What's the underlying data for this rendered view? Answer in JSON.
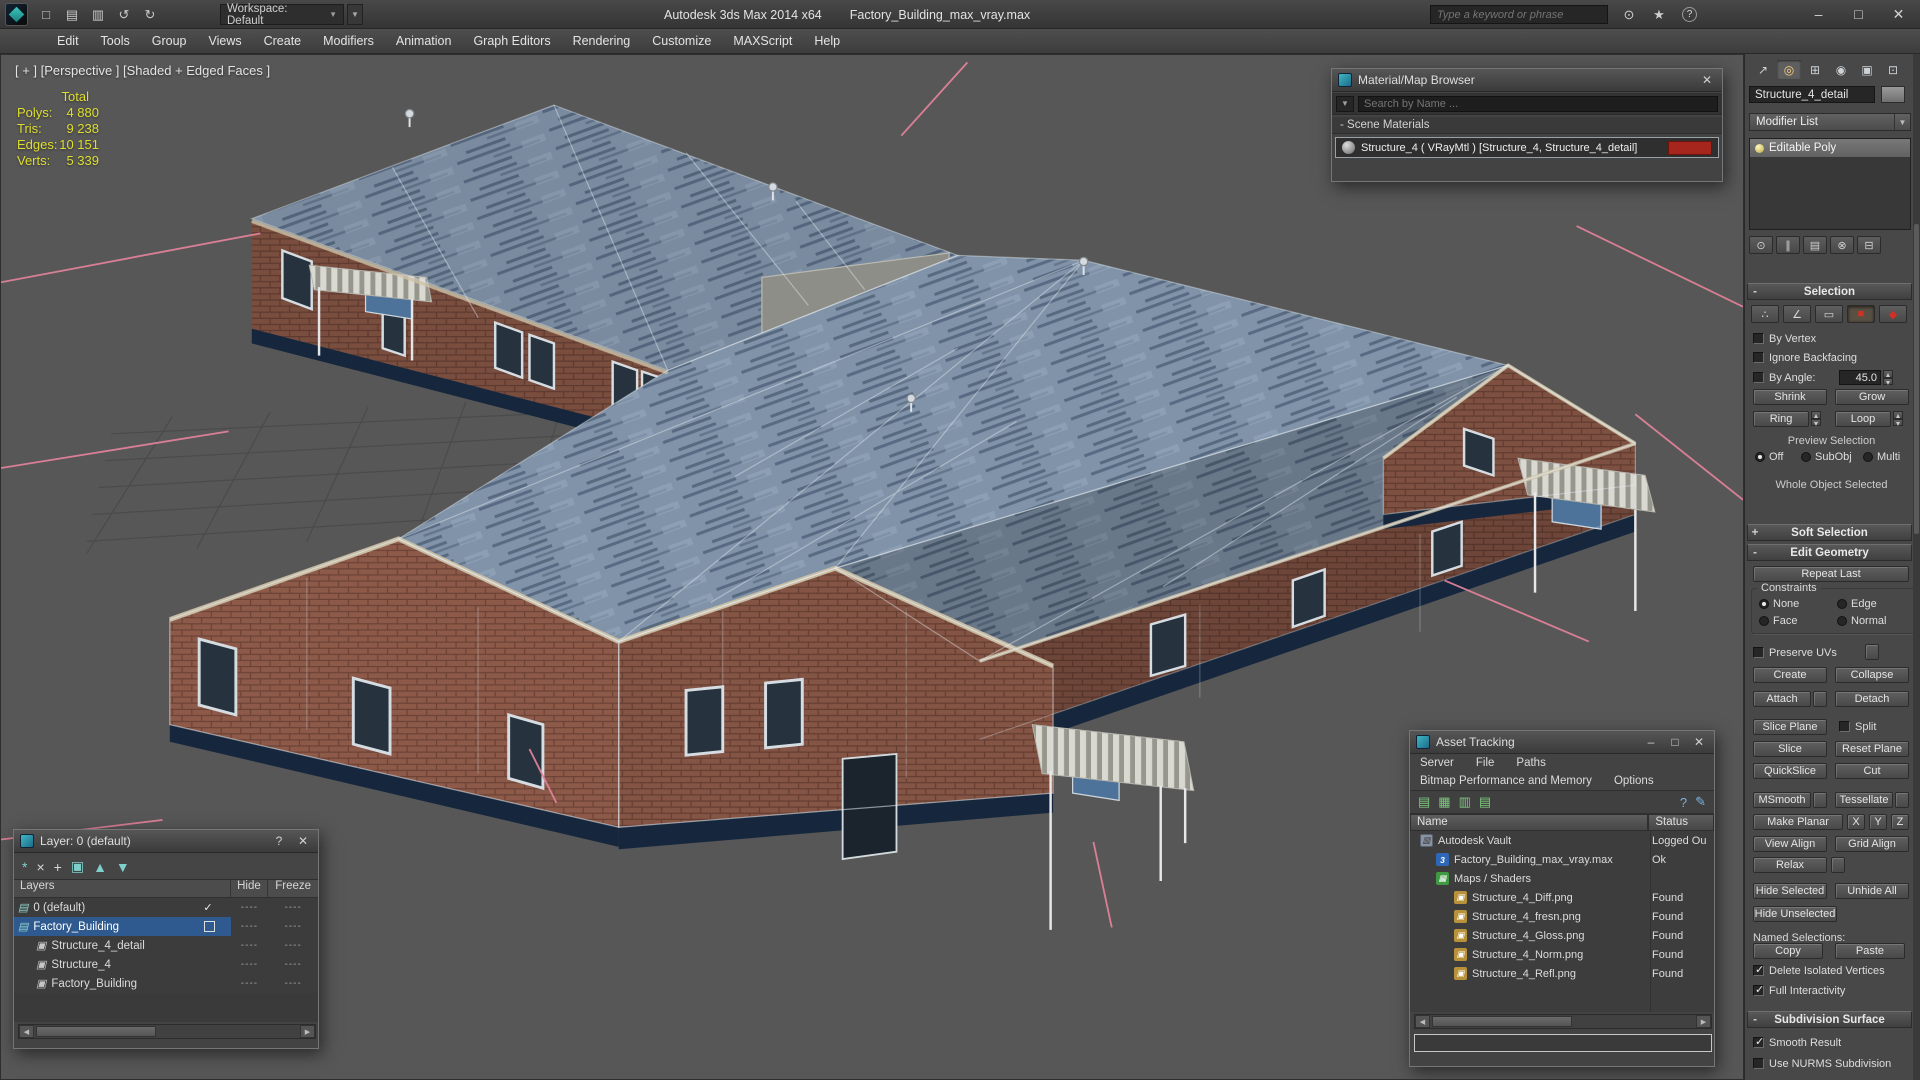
{
  "titlebar": {
    "app_title": "Autodesk 3ds Max 2014 x64",
    "file_name": "Factory_Building_max_vray.max",
    "workspace": "Workspace: Default",
    "search_placeholder": "Type a keyword or phrase"
  },
  "menus": [
    "Edit",
    "Tools",
    "Group",
    "Views",
    "Create",
    "Modifiers",
    "Animation",
    "Graph Editors",
    "Rendering",
    "Customize",
    "MAXScript",
    "Help"
  ],
  "viewport": {
    "label": "[ + ] [Perspective ] [Shaded + Edged Faces ]",
    "stats": {
      "total": "Total",
      "rows": [
        {
          "label": "Polys:",
          "value": "4 880"
        },
        {
          "label": "Tris:",
          "value": "9 238"
        },
        {
          "label": "Edges:",
          "value": "10 151"
        },
        {
          "label": "Verts:",
          "value": "5 339"
        }
      ]
    }
  },
  "material_browser": {
    "title": "Material/Map Browser",
    "search_placeholder": "Search by Name ...",
    "section": "- Scene Materials",
    "material_name": "Structure_4 ( VRayMtl ) [Structure_4, Structure_4_detail]"
  },
  "layer_panel": {
    "title": "Layer: 0 (default)",
    "columns": [
      "Layers",
      "Hide",
      "Freeze"
    ],
    "dash": "----",
    "rows": [
      {
        "name": "0 (default)"
      },
      {
        "name": "Factory_Building"
      },
      {
        "name": "Structure_4_detail"
      },
      {
        "name": "Structure_4"
      },
      {
        "name": "Factory_Building"
      }
    ]
  },
  "asset_tracking": {
    "title": "Asset Tracking",
    "menu": [
      "Server",
      "File",
      "Paths"
    ],
    "menu2": [
      "Bitmap Performance and Memory",
      "Options"
    ],
    "columns": [
      "Name",
      "Status"
    ],
    "rows": [
      {
        "name": "Autodesk Vault",
        "status": "Logged Out"
      },
      {
        "name": "Factory_Building_max_vray.max",
        "status": "Ok"
      },
      {
        "name": "Maps / Shaders",
        "status": ""
      },
      {
        "name": "Structure_4_Diff.png",
        "status": "Found"
      },
      {
        "name": "Structure_4_fresn.png",
        "status": "Found"
      },
      {
        "name": "Structure_4_Gloss.png",
        "status": "Found"
      },
      {
        "name": "Structure_4_Norm.png",
        "status": "Found"
      },
      {
        "name": "Structure_4_Refl.png",
        "status": "Found"
      }
    ]
  },
  "command_panel": {
    "object_name": "Structure_4_detail",
    "modifier_list": "Modifier List",
    "stack": [
      "Editable Poly"
    ],
    "selection": {
      "title": "Selection",
      "by_vertex": "By Vertex",
      "ignore_backfacing": "Ignore Backfacing",
      "by_angle": "By Angle:",
      "angle": "45.0",
      "shrink": "Shrink",
      "grow": "Grow",
      "ring": "Ring",
      "loop": "Loop",
      "preview": "Preview Selection",
      "off": "Off",
      "subobj": "SubObj",
      "multi": "Multi",
      "whole_object": "Whole Object Selected"
    },
    "soft_selection": {
      "title": "Soft Selection"
    },
    "edit_geometry": {
      "title": "Edit Geometry",
      "repeat_last": "Repeat Last",
      "constraints": "Constraints",
      "none": "None",
      "edge": "Edge",
      "face": "Face",
      "normal": "Normal",
      "preserve_uvs": "Preserve UVs",
      "create": "Create",
      "collapse": "Collapse",
      "attach": "Attach",
      "detach": "Detach",
      "slice_plane": "Slice Plane",
      "split": "Split",
      "slice": "Slice",
      "reset_plane": "Reset Plane",
      "quickslice": "QuickSlice",
      "cut": "Cut",
      "msmooth": "MSmooth",
      "tessellate": "Tessellate",
      "make_planar": "Make Planar",
      "x": "X",
      "y": "Y",
      "z": "Z",
      "view_align": "View Align",
      "grid_align": "Grid Align",
      "relax": "Relax",
      "hide_selected": "Hide Selected",
      "unhide_all": "Unhide All",
      "hide_unselected": "Hide Unselected",
      "named_selections": "Named Selections:",
      "copy": "Copy",
      "paste": "Paste",
      "delete_isolated": "Delete Isolated Vertices",
      "full_interactivity": "Full Interactivity"
    },
    "subdivision": {
      "title": "Subdivision Surface",
      "smooth_result": "Smooth Result",
      "use_nurms": "Use NURMS Subdivision"
    }
  },
  "glyphs": {
    "tabs": [
      "↗",
      "◎",
      "⊞",
      "◉",
      "▣",
      "⊡"
    ],
    "quick": [
      "□",
      "▤",
      "▥",
      "↺",
      "↻"
    ],
    "right_icons": [
      "⊙",
      "★",
      "?"
    ],
    "stack_tools": [
      "⊙",
      "∥",
      "▤",
      "⊗",
      "⊟"
    ],
    "subobj": [
      "∴",
      "∠",
      "▭",
      "■",
      "◆"
    ],
    "layer_tools": [
      "*",
      "×",
      "+",
      "▣",
      "▲",
      "▼"
    ],
    "asset_tools": [
      "▤",
      "▦",
      "▥",
      "▤"
    ],
    "asset_tools_right": [
      "?",
      "✎"
    ],
    "funnel": "▼",
    "dropdown": "▼",
    "up": "▲",
    "down": "▼",
    "left": "◀",
    "right": "▶",
    "close": "✕",
    "minimize": "–",
    "maximize": "□",
    "help": "?",
    "check": "✓",
    "max_badge": "3",
    "maps": "▦",
    "img": "▣",
    "vault": "▥",
    "layer_icon": "▤",
    "object_icon": "▣",
    "plus": "+",
    "minus": "-"
  },
  "scene_colors": {
    "brick": "#8d5a49",
    "roof": "#8193a8",
    "foundation": "#16273d",
    "selection_pink": "#e08299",
    "stats_yellow": "#dede2e",
    "material_swatch": "#a6251c",
    "layer_selection": "#2f5a8f",
    "viewport_bg": "#575757"
  }
}
